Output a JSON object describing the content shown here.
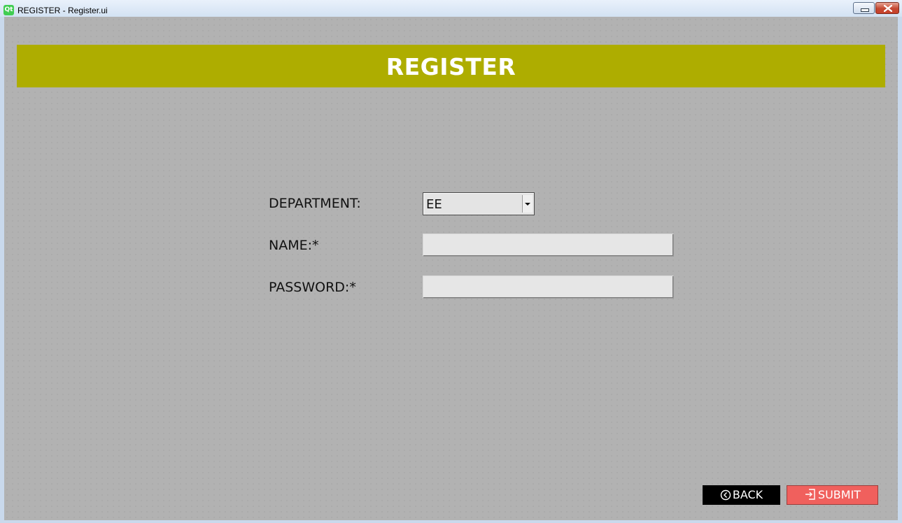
{
  "window": {
    "title": "REGISTER - Register.ui",
    "app_icon": "Qt"
  },
  "header": {
    "title": "REGISTER"
  },
  "form": {
    "department": {
      "label": "DEPARTMENT:",
      "value": "EE"
    },
    "name": {
      "label": "NAME:*",
      "value": ""
    },
    "password": {
      "label": "PASSWORD:*",
      "value": ""
    }
  },
  "buttons": {
    "back_label": "BACK",
    "back_icon": "circle-chevron-left-icon",
    "submit_label": "SUBMIT",
    "submit_icon": "login-arrow-icon"
  },
  "colors": {
    "header_bg": "#aead00",
    "background": "#b2b2b2",
    "back_bg": "#000000",
    "submit_bg": "#f0605d"
  }
}
